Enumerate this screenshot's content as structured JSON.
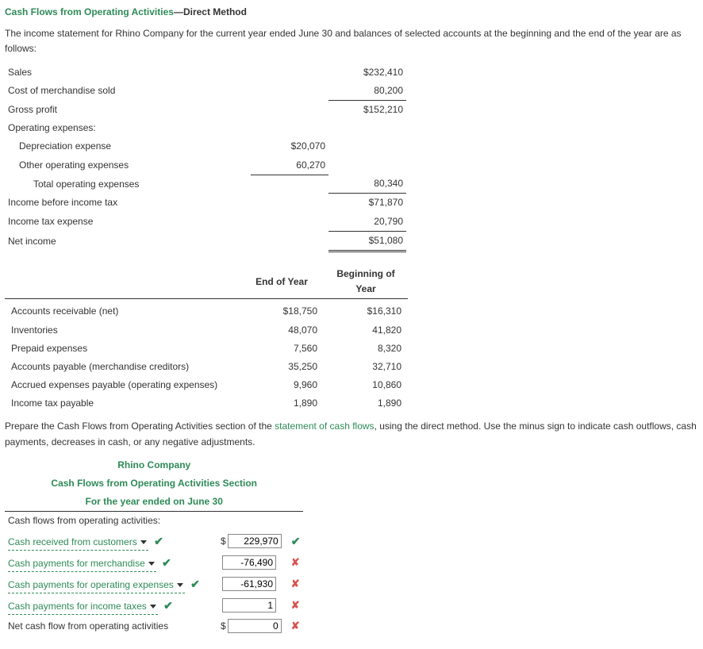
{
  "header": {
    "title_green": "Cash Flows from Operating Activities",
    "title_dash": "—",
    "title_black": "Direct Method"
  },
  "intro": "The income statement for Rhino Company for the current year ended June 30 and balances of selected accounts at the beginning and the end of the year are as follows:",
  "income": {
    "sales_label": "Sales",
    "sales_value": "$232,410",
    "cogs_label": "Cost of merchandise sold",
    "cogs_value": "80,200",
    "gp_label": "Gross profit",
    "gp_value": "$152,210",
    "opex_header": "Operating expenses:",
    "dep_label": "Depreciation expense",
    "dep_value": "$20,070",
    "other_label": "Other operating expenses",
    "other_value": "60,270",
    "total_opex_label": "Total operating expenses",
    "total_opex_value": "80,340",
    "ibt_label": "Income before income tax",
    "ibt_value": "$71,870",
    "tax_label": "Income tax expense",
    "tax_value": "20,790",
    "ni_label": "Net income",
    "ni_value": "$51,080"
  },
  "balances": {
    "eoy_header": "End of Year",
    "boy_header": "Beginning of Year",
    "rows": [
      {
        "label": "Accounts receivable (net)",
        "eoy": "$18,750",
        "boy": "$16,310"
      },
      {
        "label": "Inventories",
        "eoy": "48,070",
        "boy": "41,820"
      },
      {
        "label": "Prepaid expenses",
        "eoy": "7,560",
        "boy": "8,320"
      },
      {
        "label": "Accounts payable (merchandise creditors)",
        "eoy": "35,250",
        "boy": "32,710"
      },
      {
        "label": "Accrued expenses payable (operating expenses)",
        "eoy": "9,960",
        "boy": "10,860"
      },
      {
        "label": "Income tax payable",
        "eoy": "1,890",
        "boy": "1,890"
      }
    ]
  },
  "instruction": {
    "pre": "Prepare the Cash Flows from Operating Activities section of the ",
    "link": "statement of cash flows",
    "post": ", using the direct method. Use the minus sign to indicate cash outflows, cash payments, decreases in cash, or any negative adjustments."
  },
  "stmt": {
    "company": "Rhino Company",
    "section": "Cash Flows from Operating Activities Section",
    "period": "For the year ended on June 30",
    "opact_header": "Cash flows from operating activities:",
    "rows": [
      {
        "label": "Cash received from customers",
        "value": "229,970",
        "dollar": "$",
        "mark": "check"
      },
      {
        "label": "Cash payments for merchandise",
        "value": "-76,490",
        "dollar": "",
        "mark": "cross"
      },
      {
        "label": "Cash payments for operating expenses",
        "value": "-61,930",
        "dollar": "",
        "mark": "cross"
      },
      {
        "label": "Cash payments for income taxes",
        "value": "1",
        "dollar": "",
        "mark": "cross"
      }
    ],
    "net_label": "Net cash flow from operating activities",
    "net_value": "0",
    "net_dollar": "$",
    "net_mark": "cross"
  }
}
